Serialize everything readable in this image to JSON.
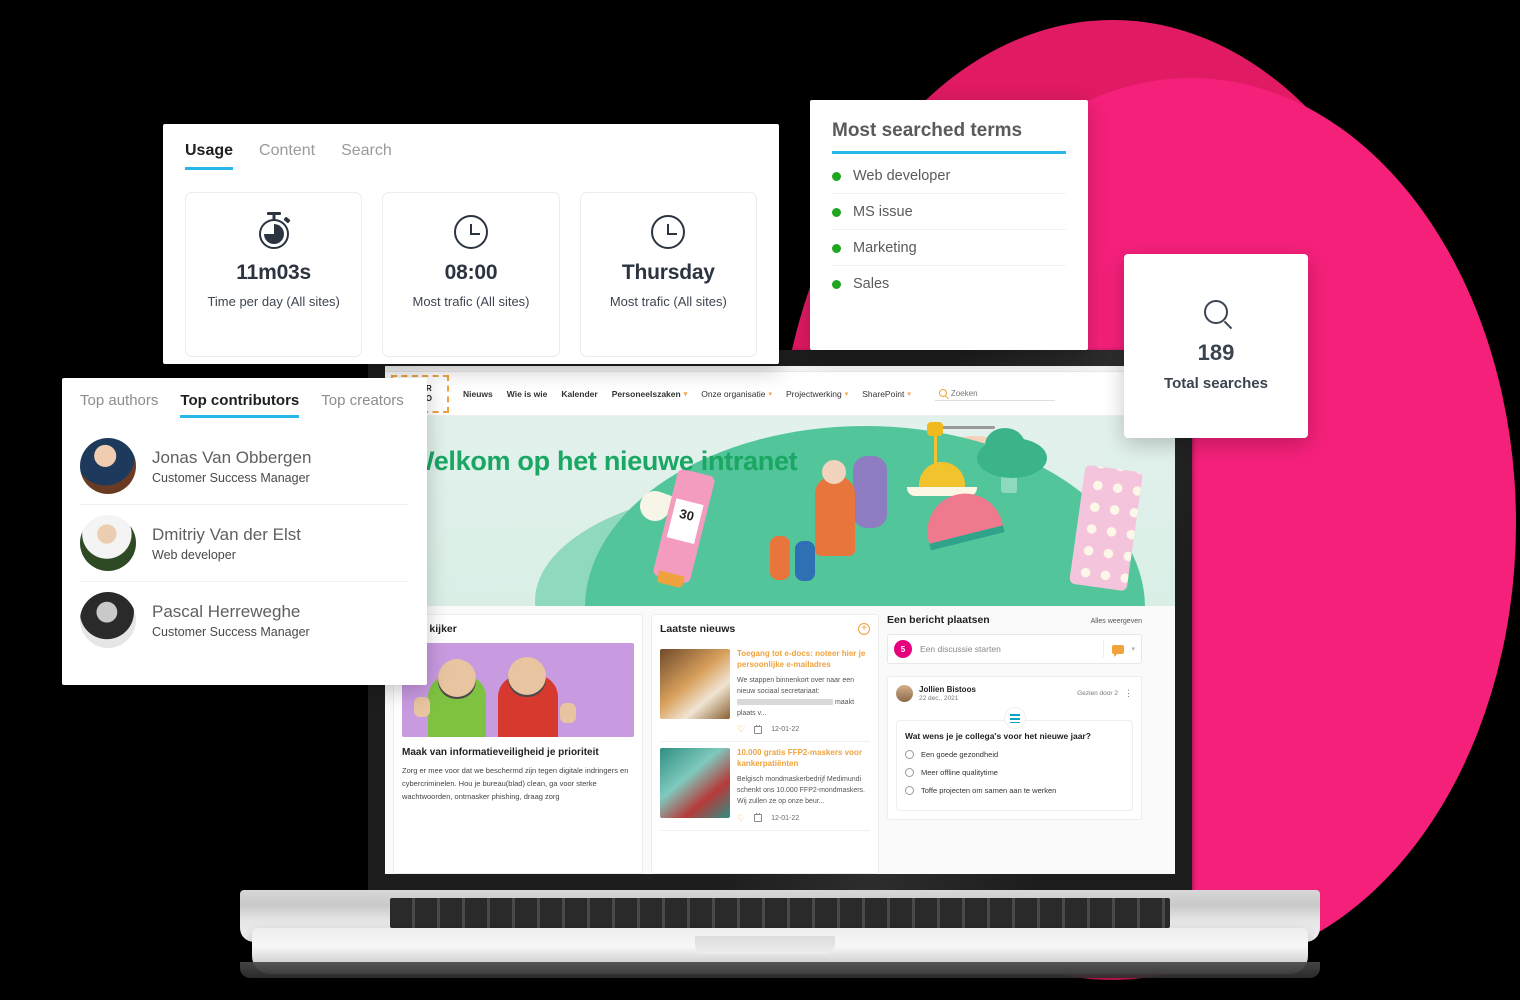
{
  "theme": {
    "pink_dark": "#e01a63",
    "pink_bright": "#f5207a",
    "accent_blue": "#29b6e8",
    "accent_orange": "#f0a33c",
    "accent_green": "#1aa663",
    "dot_green": "#1fa61f",
    "background": "#000000"
  },
  "usage_card": {
    "tabs": [
      {
        "label": "Usage",
        "active": true
      },
      {
        "label": "Content",
        "active": false
      },
      {
        "label": "Search",
        "active": false
      }
    ],
    "stats": [
      {
        "icon": "stopwatch-icon",
        "value": "11m03s",
        "label": "Time per day (All sites)"
      },
      {
        "icon": "clock-icon",
        "value": "08:00",
        "label": "Most trafic (All sites)"
      },
      {
        "icon": "clock-icon",
        "value": "Thursday",
        "label": "Most trafic (All sites)"
      }
    ]
  },
  "terms_card": {
    "title": "Most searched terms",
    "terms": [
      "Web developer",
      "MS issue",
      "Marketing",
      "Sales"
    ]
  },
  "total_card": {
    "icon": "search-icon",
    "value": "189",
    "label": "Total searches"
  },
  "contributors_card": {
    "tabs": [
      {
        "label": "Top authors",
        "active": false
      },
      {
        "label": "Top contributors",
        "active": true
      },
      {
        "label": "Top creators",
        "active": false
      }
    ],
    "people": [
      {
        "name": "Jonas Van Obbergen",
        "role": "Customer Success Manager"
      },
      {
        "name": "Dmitriy Van der Elst",
        "role": "Web developer"
      },
      {
        "name": "Pascal Herreweghe",
        "role": "Customer Success Manager"
      }
    ]
  },
  "intranet": {
    "logo": {
      "line1": "YOUR",
      "line2": "LOGO"
    },
    "nav": [
      {
        "label": "Nieuws",
        "bold": true,
        "caret": false
      },
      {
        "label": "Wie is wie",
        "bold": true,
        "caret": false
      },
      {
        "label": "Kalender",
        "bold": true,
        "caret": false
      },
      {
        "label": "Personeelszaken",
        "bold": true,
        "caret": true
      },
      {
        "label": "Onze organisatie",
        "bold": false,
        "caret": true
      },
      {
        "label": "Projectwerking",
        "bold": false,
        "caret": true
      },
      {
        "label": "SharePoint",
        "bold": false,
        "caret": true
      }
    ],
    "search_placeholder": "Zoeken",
    "hero": {
      "title": "Welkom op het nieuwe intranet"
    },
    "spotlight": {
      "section_title": "In de kijker",
      "headline": "Maak van informatieveiligheid je prioriteit",
      "body": "Zorg er mee voor dat we beschermd zijn tegen digitale indringers en cybercriminelen. Hou je bureau(blad) clean, ga voor sterke wachtwoorden, ontmasker phishing, draag zorg"
    },
    "news": {
      "section_title": "Laatste nieuws",
      "items": [
        {
          "title": "Toegang tot e-docs: noteer hier je persoonlijke e-mailadres",
          "text_before": "We stappen binnenkort over naar een nieuw sociaal secretariaat:",
          "text_after": "maakt plaats v...",
          "date": "12-01-22"
        },
        {
          "title": "10.000 gratis FFP2-maskers voor kankerpatiënten",
          "text_before": "Belgisch mondmaskerbedrijf Medimundi schenkt ons 10.000 FFP2-mondmaskers. Wij zullen ze op onze beur...",
          "text_after": "",
          "date": "12-01-22"
        }
      ]
    },
    "post": {
      "section_title": "Een bericht plaatsen",
      "view_all": "Alles weergeven",
      "start_badge": "5",
      "start_placeholder": "Een discussie starten",
      "author": "Jollien Bistoos",
      "date": "22 dec., 2021",
      "seen_by": "Gezien door 2",
      "poll_question": "Wat wens je je collega's voor het nieuwe jaar?",
      "poll_options": [
        "Een goede gezondheid",
        "Meer offline qualitytime",
        "Toffe projecten om samen aan te werken"
      ]
    }
  }
}
